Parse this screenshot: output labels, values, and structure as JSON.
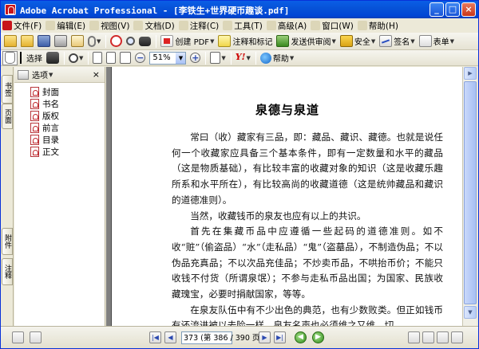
{
  "window": {
    "title": "Adobe Acrobat Professional - [李铁生+世界硬币趣谈.pdf]",
    "controls": {
      "minimize": "_",
      "maximize": "□",
      "close": "×"
    }
  },
  "menu": {
    "items": [
      {
        "label": "文件(F)"
      },
      {
        "label": "编辑(E)"
      },
      {
        "label": "视图(V)"
      },
      {
        "label": "文档(D)"
      },
      {
        "label": "注释(C)"
      },
      {
        "label": "工具(T)"
      },
      {
        "label": "高级(A)"
      },
      {
        "label": "窗口(W)"
      },
      {
        "label": "帮助(H)"
      }
    ]
  },
  "toolbar1": {
    "create_pdf": "创建 PDF",
    "comment_markup": "注释和标记",
    "send_review": "发送供审阅",
    "security": "安全",
    "sign": "签名",
    "forms": "表单"
  },
  "toolbar2": {
    "select_label": "选择",
    "zoom_value": "51%",
    "help_label": "帮助"
  },
  "left_tabs": {
    "bookmarks": "书签",
    "pages": "页面",
    "attachments": "附件",
    "comments": "注释"
  },
  "bookmarks_panel": {
    "options_label": "选项",
    "close": "×",
    "items": [
      {
        "label": "封面"
      },
      {
        "label": "书名"
      },
      {
        "label": "版权"
      },
      {
        "label": "前言"
      },
      {
        "label": "目录"
      },
      {
        "label": "正文"
      }
    ]
  },
  "document": {
    "title": "泉德与泉道",
    "paragraphs": [
      "常曰（收）藏家有三品，即：藏品、藏识、藏德。也就是说任何一个收藏家应具备三个基本条件，即有一定数量和水平的藏品（这是物质基础），有比较丰富的收藏对象的知识（这是收藏乐趣所系和水平所在），有比较高尚的收藏道德（这是统帅藏品和藏识的道德准则）。",
      "当然，收藏钱币的泉友也应有以上的共识。",
      "首先在集藏币品中应遵循一些起码的道德准则。如不收“赃”（偷盗品）“水”（走私品）“鬼”（盗墓品），不制造伪品；不以伪品充真品；不以次品充佳品；不炒卖币品，不哄抬币价；不能只收钱不付货（所谓泉氓）；不参与走私币品出国；为国家、民族收藏瑰宝，必要时捐献国家，等等。",
      "在泉友队伍中有不少出色的典范，也有少数败类。但正如钱币有还流进被以去险一样，泉友名声也必须维之又维。切"
    ]
  },
  "statusbar": {
    "page_indicator": "373 (第 386 / 390 页)"
  }
}
